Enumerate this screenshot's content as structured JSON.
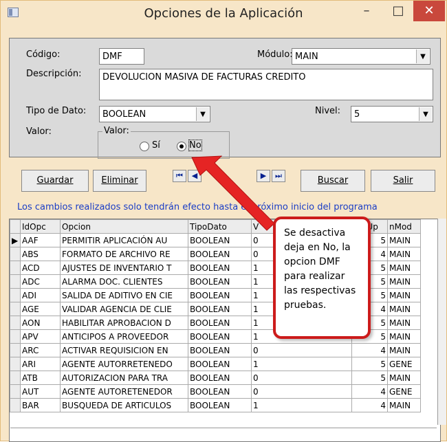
{
  "window": {
    "title": "Opciones de la Aplicación",
    "minimize": "–",
    "maximize": "□",
    "close": "✕"
  },
  "form": {
    "codigo_label": "Código:",
    "codigo_value": "DMF",
    "modulo_label": "Módulo:",
    "modulo_value": "MAIN",
    "descripcion_label": "Descripción:",
    "descripcion_value": "DEVOLUCION MASIVA DE FACTURAS CREDITO",
    "tipo_label": "Tipo de Dato:",
    "tipo_value": "BOOLEAN",
    "nivel_label": "Nivel:",
    "nivel_value": "5",
    "valor_label": "Valor:",
    "group_title": "Valor:",
    "si_label": "Sí",
    "no_label": "No",
    "selected": "No"
  },
  "buttons": {
    "guardar": "Guardar",
    "eliminar": "Eliminar",
    "buscar": "Buscar",
    "salir": "Salir"
  },
  "nav": {
    "first": "⏮",
    "prev": "◀",
    "next": "▶",
    "last": "⏭"
  },
  "notice": "Los cambios realizados solo tendrán efecto hasta el próximo inicio del programa",
  "callout": "Se desactiva deja en No, la opcion DMF para realizar las respectivas pruebas.",
  "table": {
    "headers": [
      "IdOpc",
      "Opcion",
      "TipoDato",
      "V",
      "NivUp",
      "nMod"
    ],
    "rows": [
      [
        "AAF",
        "PERMITIR APLICACIÓN AU",
        "BOOLEAN",
        "0",
        "5",
        "MAIN"
      ],
      [
        "ABS",
        "FORMATO DE ARCHIVO RE",
        "BOOLEAN",
        "0",
        "4",
        "MAIN"
      ],
      [
        "ACD",
        "AJUSTES DE INVENTARIO T",
        "BOOLEAN",
        "1",
        "5",
        "MAIN"
      ],
      [
        "ADC",
        "ALARMA DOC. CLIENTES",
        "BOOLEAN",
        "1",
        "5",
        "MAIN"
      ],
      [
        "ADI",
        "SALIDA DE ADITIVO EN CIE",
        "BOOLEAN",
        "1",
        "5",
        "MAIN"
      ],
      [
        "AGE",
        "VALIDAR AGENCIA DE CLIE",
        "BOOLEAN",
        "1",
        "4",
        "MAIN"
      ],
      [
        "AON",
        "HABILITAR APROBACION D",
        "BOOLEAN",
        "1",
        "5",
        "MAIN"
      ],
      [
        "APV",
        "ANTICIPOS A PROVEEDOR",
        "BOOLEAN",
        "1",
        "5",
        "MAIN"
      ],
      [
        "ARC",
        "ACTIVAR REQUISICION EN",
        "BOOLEAN",
        "0",
        "4",
        "MAIN"
      ],
      [
        "ARI",
        "AGENTE AUTORRETENEDO",
        "BOOLEAN",
        "1",
        "5",
        "GENE"
      ],
      [
        "ATB",
        "AUTORIZACION PARA TRA",
        "BOOLEAN",
        "0",
        "5",
        "MAIN"
      ],
      [
        "AUT",
        "AGENTE AUTORETENEDOR",
        "BOOLEAN",
        "0",
        "4",
        "GENE"
      ],
      [
        "BAR",
        "BUSQUEDA DE ARTICULOS",
        "BOOLEAN",
        "1",
        "4",
        "MAIN"
      ]
    ]
  }
}
